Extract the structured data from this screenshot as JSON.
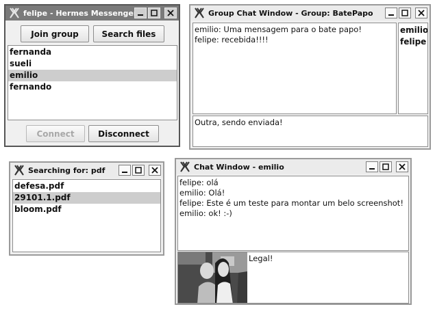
{
  "messenger": {
    "title": "felipe - Hermes Messenger",
    "join_label": "Join group",
    "search_label": "Search files",
    "contacts": [
      {
        "name": "fernanda",
        "selected": false
      },
      {
        "name": "sueli",
        "selected": false
      },
      {
        "name": "emilio",
        "selected": true
      },
      {
        "name": "fernando",
        "selected": false
      }
    ],
    "connect_label": "Connect",
    "disconnect_label": "Disconnect"
  },
  "group_chat": {
    "title": "Group Chat Window - Group: BatePapo",
    "messages": [
      "emilio: Uma mensagem para o bate papo!",
      "felipe: recebida!!!!"
    ],
    "members": [
      "emilio",
      "felipe"
    ],
    "input_value": "Outra, sendo enviada!"
  },
  "search": {
    "title": "Searching for: pdf",
    "results": [
      {
        "name": "defesa.pdf",
        "selected": false
      },
      {
        "name": "29101.1.pdf",
        "selected": true
      },
      {
        "name": "bloom.pdf",
        "selected": false
      }
    ]
  },
  "chat": {
    "title": "Chat Window - emilio",
    "messages": [
      "felipe: olá",
      "emilio: Olá!",
      "felipe: Este é um teste para montar um belo screenshot!",
      "emilio: ok! :-)"
    ],
    "input_value": "Legal!"
  },
  "icons": {
    "app": "x-logo-icon",
    "minimize": "minimize-icon",
    "maximize": "maximize-icon",
    "close": "close-icon"
  }
}
